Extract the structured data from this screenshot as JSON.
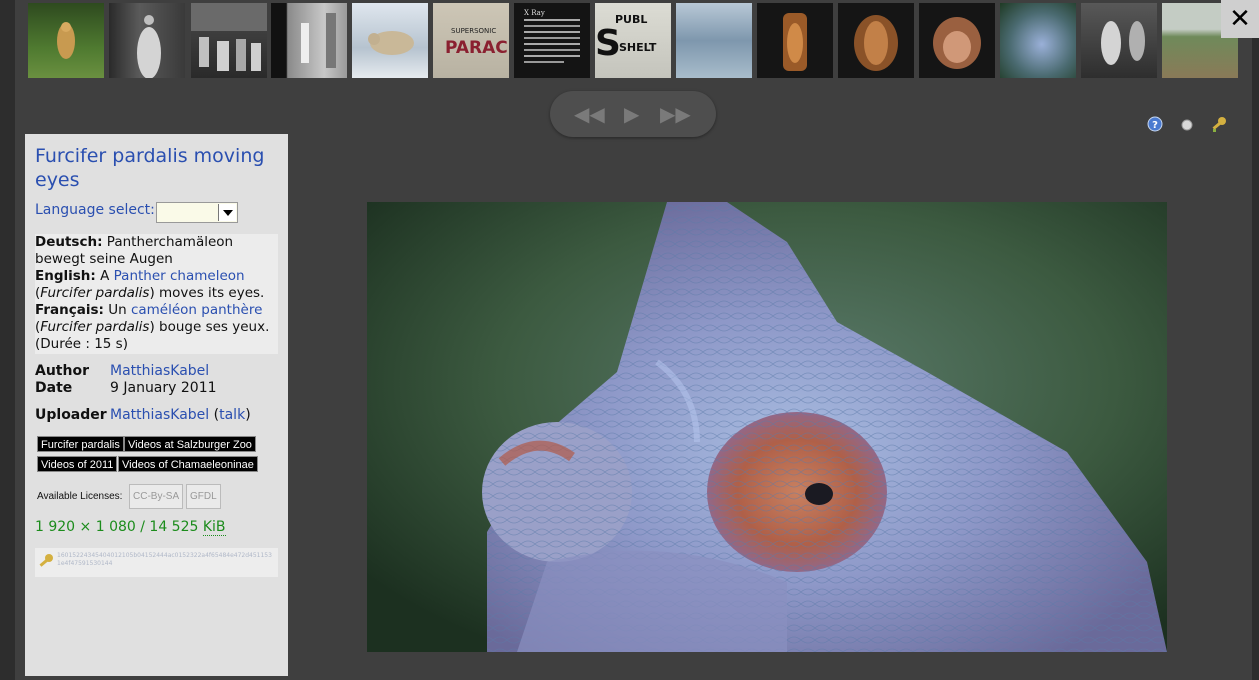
{
  "thumbnails": [
    {
      "name": "cheetah",
      "colors": [
        "#5c7a3a",
        "#c8a050"
      ]
    },
    {
      "name": "woman-portrait",
      "colors": [
        "#2a2a2a",
        "#d8d8d8"
      ]
    },
    {
      "name": "group-photo",
      "colors": [
        "#3a3a3a",
        "#bdbdbd"
      ]
    },
    {
      "name": "people-room",
      "colors": [
        "#222222",
        "#9a9a9a"
      ]
    },
    {
      "name": "polar-bear",
      "colors": [
        "#a8b8c8",
        "#e8eef2"
      ]
    },
    {
      "name": "supersonic",
      "colors": [
        "#d0c8b8",
        "#8a2030"
      ],
      "text": "PARAC",
      "subtext": "SUPERSONIC"
    },
    {
      "name": "xray-text",
      "colors": [
        "#141414",
        "#d0d0d0"
      ],
      "text": "X Ray"
    },
    {
      "name": "public-shelter",
      "colors": [
        "#d8d8d0",
        "#1a1a1a"
      ],
      "text": "S",
      "subtext": "PUBL SHELT"
    },
    {
      "name": "water",
      "colors": [
        "#8fa8bd",
        "#c8d8e4"
      ]
    },
    {
      "name": "ultrasound-1",
      "colors": [
        "#151515",
        "#c07a40"
      ]
    },
    {
      "name": "ultrasound-2",
      "colors": [
        "#151515",
        "#c07a40"
      ]
    },
    {
      "name": "ultrasound-face",
      "colors": [
        "#151515",
        "#c89070"
      ]
    },
    {
      "name": "chameleon",
      "colors": [
        "#2a4a2a",
        "#8aa8d0"
      ]
    },
    {
      "name": "men-working",
      "colors": [
        "#2a2a2a",
        "#cfcfcf"
      ]
    },
    {
      "name": "landscape",
      "colors": [
        "#7a9068",
        "#b8c4b8"
      ]
    }
  ],
  "controls": {
    "prev": "◀◀",
    "play": "▶",
    "next": "▶▶"
  },
  "file": {
    "title": "Furcifer pardalis moving eyes"
  },
  "language_select": {
    "label": "Language select:",
    "value": ""
  },
  "description": {
    "de_label": "Deutsch:",
    "de_text": "Pantherchamäleon bewegt seine Augen",
    "en_label": "English:",
    "en_text_1": "A",
    "en_link": "Panther chameleon",
    "en_text_2": "(",
    "en_italic": "Furcifer pardalis",
    "en_text_3": ") moves its eyes.",
    "fr_label": "Français:",
    "fr_text_1": "Un",
    "fr_link": "caméléon panthère",
    "fr_text_2": "(",
    "fr_italic": "Furcifer pardalis",
    "fr_text_3": ") bouge ses yeux. (Durée : 15 s)"
  },
  "meta": {
    "author_label": "Author",
    "author_value": "MatthiasKabel",
    "date_label": "Date",
    "date_value": "9 January 2011",
    "uploader_label": "Uploader",
    "uploader_value": "MatthiasKabel",
    "talk_open": "(",
    "talk_label": "talk",
    "talk_close": ")"
  },
  "categories": [
    "Furcifer pardalis",
    "Videos at Salzburger Zoo",
    "Videos of 2011",
    "Videos of Chamaeleoninae"
  ],
  "licenses": {
    "label": "Available Licenses:",
    "items": [
      "CC-By-SA",
      "GFDL"
    ]
  },
  "dimensions": {
    "text": "1 920 × 1 080 / 14 525",
    "unit": "KiB"
  },
  "hash": "16015224345404012105b04152444ac0152322a4f65484e472d4511531e4f47591530144",
  "colors": {
    "link": "#2a4fb0",
    "green": "#1c8c1c",
    "background": "#3f3f3f",
    "panel": "#e0e0e0"
  }
}
